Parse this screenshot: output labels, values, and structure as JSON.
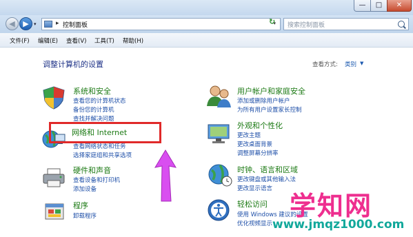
{
  "window": {
    "caption_buttons": {
      "minimize": "—",
      "maximize": "□",
      "close": "✕"
    }
  },
  "nav": {
    "back_icon": "arrow-left-icon",
    "forward_icon": "arrow-right-icon",
    "breadcrumb_separator": "▸",
    "address": "控制面板",
    "address_dropdown": "▾",
    "refresh_glyph": "↻",
    "search_placeholder": "搜索控制面板",
    "history_glyph": "▾"
  },
  "menu": [
    "文件(F)",
    "编辑(E)",
    "查看(V)",
    "工具(T)",
    "帮助(H)"
  ],
  "content": {
    "heading": "调整计算机的设置",
    "view_by_label": "查看方式:",
    "view_by_value": "类别",
    "view_by_caret": "▼",
    "categories": [
      {
        "title": "系统和安全",
        "icon": "shield-icon",
        "links": [
          "查看您的计算机状态",
          "备份您的计算机",
          "查找并解决问题"
        ]
      },
      {
        "title": "网络和 Internet",
        "icon": "network-icon",
        "links": [
          "查看网络状态和任务",
          "选择家庭组和共享选项"
        ]
      },
      {
        "title": "硬件和声音",
        "icon": "printer-icon",
        "links": [
          "查看设备和打印机",
          "添加设备"
        ]
      },
      {
        "title": "程序",
        "icon": "programs-icon",
        "links": [
          "卸载程序"
        ]
      },
      {
        "title": "用户帐户和家庭安全",
        "icon": "users-icon",
        "links": [
          "添加或删除用户帐户",
          "为所有用户设置家长控制"
        ]
      },
      {
        "title": "外观和个性化",
        "icon": "appearance-icon",
        "links": [
          "更改主题",
          "更改桌面背景",
          "调整屏幕分辨率"
        ]
      },
      {
        "title": "时钟、语言和区域",
        "icon": "globe-clock-icon",
        "links": [
          "更改键盘或其他输入法",
          "更改显示语言"
        ]
      },
      {
        "title": "轻松访问",
        "icon": "ease-of-access-icon",
        "links": [
          "使用 Windows 建议的设置",
          "优化视频显示"
        ]
      }
    ]
  },
  "annotation": {
    "highlight_color": "#e02929",
    "arrow_color": "#d94ef0"
  },
  "watermark": {
    "brand": "学知网",
    "url": "www.jmqz1000.com",
    "brand_color": "#ee2e8f",
    "url_color": "#12a89b"
  }
}
